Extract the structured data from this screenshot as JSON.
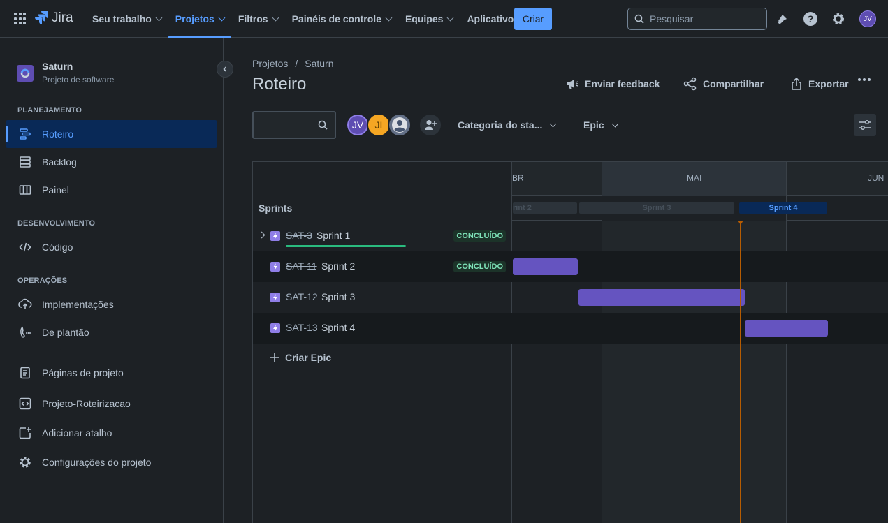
{
  "topnav": {
    "product": "Jira",
    "items": [
      {
        "label": "Seu trabalho",
        "active": false
      },
      {
        "label": "Projetos",
        "active": true
      },
      {
        "label": "Filtros",
        "active": false
      },
      {
        "label": "Painéis de controle",
        "active": false
      },
      {
        "label": "Equipes",
        "active": false
      },
      {
        "label": "Aplicativos",
        "active": false
      }
    ],
    "create_label": "Criar",
    "search_placeholder": "Pesquisar",
    "user_initials": "JV"
  },
  "sidebar": {
    "project_name": "Saturn",
    "project_type": "Projeto de software",
    "sections": {
      "planning": "PLANEJAMENTO",
      "development": "DESENVOLVIMENTO",
      "operations": "OPERAÇÕES"
    },
    "planning_items": [
      "Roteiro",
      "Backlog",
      "Painel"
    ],
    "development_items": [
      "Código"
    ],
    "operations_items": [
      "Implementações",
      "De plantão"
    ],
    "footer_items": [
      "Páginas de projeto",
      "Projeto-Roteirizacao",
      "Adicionar atalho",
      "Configurações do projeto"
    ]
  },
  "main": {
    "breadcrumb": [
      "Projetos",
      "Saturn"
    ],
    "breadcrumb_sep": "/",
    "title": "Roteiro",
    "actions": {
      "feedback": "Enviar feedback",
      "share": "Compartilhar",
      "export": "Exportar"
    },
    "avatars": [
      "JV",
      "JI"
    ],
    "filters": {
      "status_category": "Categoria do sta...",
      "epic": "Epic"
    }
  },
  "roadmap": {
    "months": [
      "BR",
      "MAI",
      "JUN"
    ],
    "sprints_label": "Sprints",
    "sprint_pills": [
      "rint 2",
      "Sprint 3",
      "Sprint 4"
    ],
    "rows": [
      {
        "key": "SAT-3",
        "summary": "Sprint 1",
        "status": "CONCLUÍDO",
        "done": true,
        "progress": 1.0
      },
      {
        "key": "SAT-11",
        "summary": "Sprint 2",
        "status": "CONCLUÍDO",
        "done": true
      },
      {
        "key": "SAT-12",
        "summary": "Sprint 3",
        "status": "",
        "done": false
      },
      {
        "key": "SAT-13",
        "summary": "Sprint 4",
        "status": "",
        "done": false
      }
    ],
    "create_epic": "Criar Epic",
    "colors": {
      "bar": "#6554c0",
      "today": "#b65c02",
      "accent": "#579dff"
    }
  }
}
